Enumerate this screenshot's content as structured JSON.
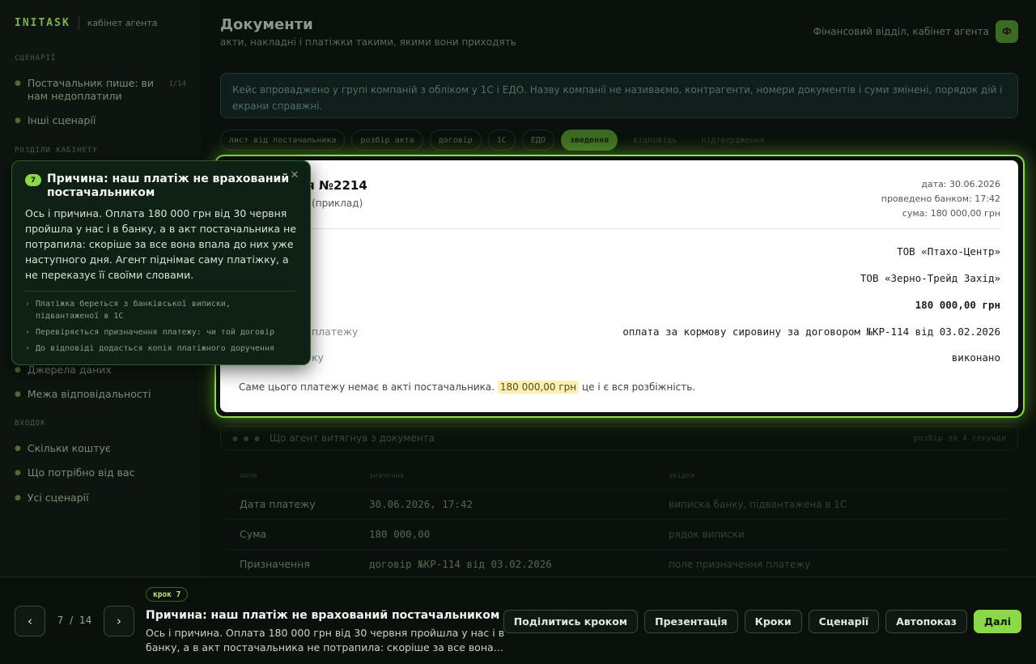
{
  "brand": {
    "name": "INITASK",
    "subtitle": "кабінет агента"
  },
  "sidebar": {
    "sections": [
      {
        "label": "СЦЕНАРІЇ",
        "items": [
          {
            "label": "Постачальник пише: ви нам недоплатили",
            "tag": "1/14"
          },
          {
            "label": "Інші сценарії"
          }
        ]
      },
      {
        "label": "РОЗДІЛИ КАБІНЕТУ",
        "items": [
          {
            "label": "Джерела даних"
          },
          {
            "label": "Межа відповідальності"
          }
        ]
      },
      {
        "label": "ВХОДОК",
        "items": [
          {
            "label": "Скільки коштує"
          },
          {
            "label": "Що потрібно від вас"
          },
          {
            "label": "Усі сценарії"
          }
        ]
      }
    ]
  },
  "header": {
    "title": "Документи",
    "subtitle": "акти, накладні і платіжки такими, якими вони приходять",
    "account": "Фінансовий відділ, кабінет агента",
    "avatar": "Ф"
  },
  "info": "Кейс впроваджено у групі компаній з обліком у 1С і ЕДО. Назву компанії не називаємо, контрагенти, номери документів і суми змінені, порядок дій і екрани справжні.",
  "tabs": [
    {
      "label": "лист від постачальника",
      "state": "normal"
    },
    {
      "label": "розбір акта",
      "state": "normal"
    },
    {
      "label": "договір",
      "state": "normal"
    },
    {
      "label": "1С",
      "state": "normal"
    },
    {
      "label": "ЕДО",
      "state": "normal"
    },
    {
      "label": "зведення",
      "state": "active"
    },
    {
      "label": "відповідь",
      "state": "ghost"
    },
    {
      "label": "підтвердження",
      "state": "ghost"
    }
  ],
  "document": {
    "title": "доручення №2214",
    "subtitle": "за 30.06.2026 (приклад)",
    "meta": [
      "дата: 30.06.2026",
      "проведено банком: 17:42",
      "сума: 180 000,00 грн"
    ],
    "rows": [
      {
        "key": "",
        "value": "ТОВ «Птахо-Центр»",
        "bold": false
      },
      {
        "key": "",
        "value": "ТОВ «Зерно-Трейд Захід»",
        "bold": false
      },
      {
        "key": "",
        "value": "180 000,00 грн",
        "bold": true
      },
      {
        "key": "платежу",
        "value": "оплата за кормову сировину за договором №КР-114 від 03.02.2026",
        "bold": false
      },
      {
        "key": "ку",
        "value": "виконано",
        "bold": false
      }
    ],
    "note_before": "Саме цього платежу немає в акті постачальника.",
    "note_highlight": "180 000,00 грн",
    "note_after": "це і є вся розбіжність."
  },
  "extraction": {
    "title": "Що агент витягнув з документа",
    "right": "розбір за 4 секунди",
    "columns": [
      "поле",
      "значення",
      "звідки"
    ],
    "rows": [
      {
        "field": "Дата платежу",
        "value": "30.06.2026, 17:42",
        "source": "виписка банку, підвантажена в 1С"
      },
      {
        "field": "Сума",
        "value": "180 000,00",
        "source": "рядок виписки"
      },
      {
        "field": "Призначення",
        "value": "договір №КР-114 від 03.02.2026",
        "source": "поле призначення платежу"
      }
    ]
  },
  "popover": {
    "number": "7",
    "title": "Причина: наш платіж не врахований постачальником",
    "body": "Ось і причина. Оплата 180 000 грн від 30 червня пройшла у нас і в банку, а в акт постачальника не потрапила: скоріше за все вона впала до них уже наступного дня. Агент піднімає саму платіжку, а не переказує її своїми словами.",
    "bullets": [
      "Платіжка береться з банківської виписки, підвантаженої в 1С",
      "Перевіряється призначення платежу: чи той договір",
      "До відповіді додасться копія платіжного доручення"
    ]
  },
  "footer": {
    "prev": "‹",
    "next": "›",
    "current": "7",
    "total": "14",
    "separator": "/",
    "step_label": "крок 7",
    "step_title": "Причина: наш платіж не врахований постачальником",
    "step_desc": "Ось і причина. Оплата 180 000 грн від 30 червня пройшла у нас і в банку, а в акт постачальника не потрапила: скоріше за все вона…",
    "actions": [
      "Поділитись кроком",
      "Презентація",
      "Кроки",
      "Сценарії",
      "Автопоказ",
      "Далі"
    ]
  }
}
